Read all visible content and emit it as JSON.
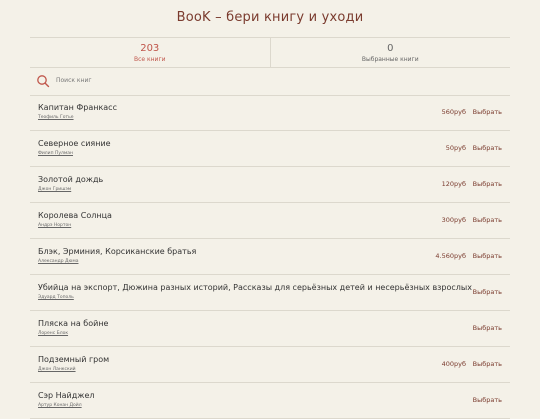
{
  "header": {
    "title": "BooK – бери книгу и уходи"
  },
  "tabs": [
    {
      "count": "203",
      "label": "Все книги"
    },
    {
      "count": "0",
      "label": "Выбранные книги"
    }
  ],
  "search": {
    "placeholder": "Поиск книг"
  },
  "select_label": "Выбрать",
  "books": [
    {
      "title": "Капитан Франкасс",
      "author": "Теофиль Готье",
      "price": "560руб"
    },
    {
      "title": "Северное сияние",
      "author": "Филип Пулман",
      "price": "50руб"
    },
    {
      "title": "Золотой дождь",
      "author": "Джон Гришэм",
      "price": "120руб"
    },
    {
      "title": "Королева Солнца",
      "author": "Андрэ Нортон",
      "price": "300руб"
    },
    {
      "title": "Блэк, Эрминия, Корсиканские братья",
      "author": "Александр Дюма",
      "price": "4.560руб"
    },
    {
      "title": "Убийца на экспорт, Дюжина разных историй, Рассказы для серьёзных детей и несерьёзных взрослых",
      "author": "Эдуард Тополь",
      "price": ""
    },
    {
      "title": "Пляска на бойне",
      "author": "Лоренс Блок",
      "price": ""
    },
    {
      "title": "Подземный гром",
      "author": "Джон Ланкский",
      "price": "400руб"
    },
    {
      "title": "Сэр Найджел",
      "author": "Артур Конан Дойл",
      "price": ""
    }
  ],
  "colors": {
    "accent": "#c0564b",
    "brand": "#7a3b2e",
    "background": "#f4f1e8"
  }
}
